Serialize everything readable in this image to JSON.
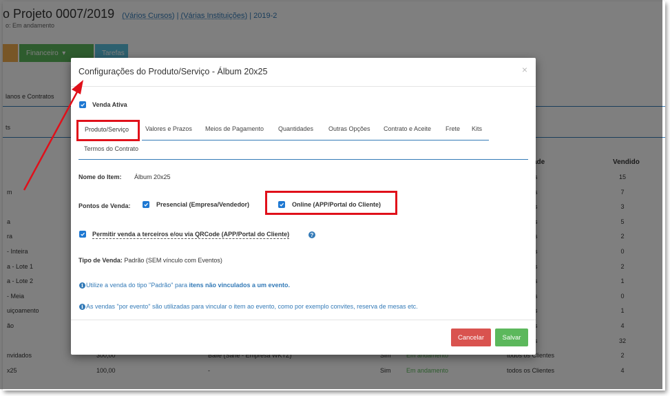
{
  "background": {
    "project_title": "o Projeto 0007/2019",
    "meta_courses": "(Vários Cursos)",
    "meta_separator": "|",
    "meta_institutions": "(Várias Instituições)",
    "meta_year": "| 2019-2",
    "subtitle": "o: Em andamento",
    "buttons": {
      "financeiro": "Financeiro",
      "tarefas": "Tarefas"
    },
    "section_planos": "lanos e Contratos",
    "section_its": "ts",
    "col_headers": {
      "quantidade": "ade",
      "vendido": "Vendido"
    },
    "rows": [
      {
        "name": "",
        "price": "",
        "event": "",
        "active": "",
        "status": "",
        "who": "os Clientes",
        "sold": "15"
      },
      {
        "name": "m",
        "price": "",
        "event": "",
        "active": "",
        "status": "",
        "who": "os Clientes",
        "sold": "7"
      },
      {
        "name": "",
        "price": "",
        "event": "",
        "active": "",
        "status": "",
        "who": "os Clientes",
        "sold": "3"
      },
      {
        "name": "a",
        "price": "",
        "event": "",
        "active": "",
        "status": "",
        "who": "os Clientes",
        "sold": "5"
      },
      {
        "name": "ra",
        "price": "",
        "event": "",
        "active": "",
        "status": "",
        "who": "os Clientes",
        "sold": "2"
      },
      {
        "name": "- Inteira",
        "price": "",
        "event": "",
        "active": "",
        "status": "",
        "who": "os Clientes",
        "sold": "0"
      },
      {
        "name": "a - Lote 1",
        "price": "",
        "event": "",
        "active": "",
        "status": "",
        "who": "os Clientes",
        "sold": "2"
      },
      {
        "name": "a - Lote 2",
        "price": "",
        "event": "",
        "active": "",
        "status": "",
        "who": "os Clientes",
        "sold": "1"
      },
      {
        "name": "- Meia",
        "price": "",
        "event": "",
        "active": "",
        "status": "",
        "who": "os Clientes",
        "sold": "0"
      },
      {
        "name": "uiçoamento",
        "price": "",
        "event": "",
        "active": "",
        "status": "",
        "who": "os Clientes",
        "sold": "1"
      },
      {
        "name": "ão",
        "price": "",
        "event": "",
        "active": "",
        "status": "",
        "who": "os Clientes",
        "sold": "4"
      },
      {
        "name": "",
        "price": "",
        "event": "",
        "active": "",
        "status": "",
        "who": "os Clientes",
        "sold": "32"
      },
      {
        "name": "nvidados",
        "price": "300,00",
        "event": "Baile (Sane - Empresa WKTZ)",
        "active": "Sim",
        "status": "Em andamento",
        "who": "todos os Clientes",
        "sold": "2"
      },
      {
        "name": "x25",
        "price": "100,00",
        "event": "-",
        "active": "Sim",
        "status": "Em andamento",
        "who": "todos os Clientes",
        "sold": "4"
      }
    ]
  },
  "modal": {
    "title": "Configurações do Produto/Serviço - Álbum 20x25",
    "close": "×",
    "venda_ativa": "Venda Ativa",
    "tabs": [
      {
        "label": "Produto/Serviço"
      },
      {
        "label": "Valores e Prazos"
      },
      {
        "label": "Meios de Pagamento"
      },
      {
        "label": "Quantidades"
      },
      {
        "label": "Outras Opções"
      },
      {
        "label": "Contrato e Aceite"
      },
      {
        "label": "Frete"
      },
      {
        "label": "Kits"
      },
      {
        "label": "Termos do Contrato"
      }
    ],
    "nome_label": "Nome do Item:",
    "nome_value": "Álbum 20x25",
    "pontos_label": "Pontos de Venda:",
    "presencial": "Presencial (Empresa/Vendedor)",
    "online": "Online (APP/Portal do Cliente)",
    "permitir": "Permitir venda a terceiros e/ou via QRCode (APP/Portal do Cliente)",
    "help": "?",
    "tipo_label": "Tipo de Venda:",
    "tipo_value": "Padrão (SEM vínculo com Eventos)",
    "info1_pre": "Utilize a venda do tipo \"Padrão\" para ",
    "info1_bold": "itens não vinculados a um evento.",
    "info2": "As vendas \"por evento\" são utilizadas para vincular o item ao evento, como por exemplo convites, reserva de mesas etc.",
    "info_icon": "i",
    "cancel": "Cancelar",
    "save": "Salvar"
  },
  "colors": {
    "accent": "#337ab7",
    "checkbox": "#1e78d2",
    "highlight": "#e0101a",
    "cancel": "#d9534f",
    "save": "#5cb85c"
  }
}
